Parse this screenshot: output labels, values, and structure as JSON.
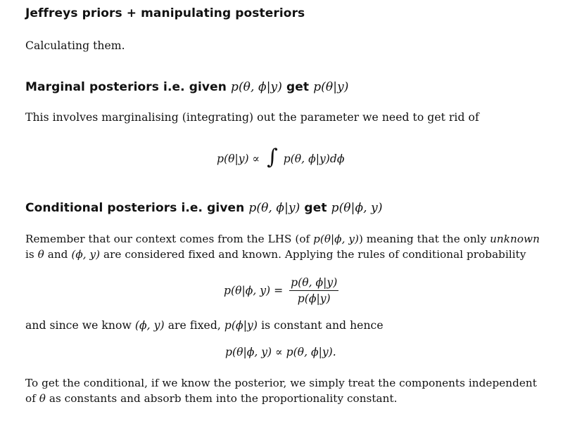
{
  "title": "Jeffreys priors + manipulating posteriors",
  "intro": "Calculating them.",
  "section1": {
    "heading_text": "Marginal posteriors i.e. given",
    "heading_math1": "p(θ, ϕ|y)",
    "heading_mid": "get",
    "heading_math2": "p(θ|y)",
    "body": "This involves marginalising (integrating) out the parameter we need to get rid of",
    "eq_lhs": "p(θ|y) ∝",
    "eq_integral": "∫",
    "eq_rhs": "p(θ, ϕ|y)dϕ"
  },
  "section2": {
    "heading_text": "Conditional posteriors i.e. given",
    "heading_math1": "p(θ, ϕ|y)",
    "heading_mid": "get",
    "heading_math2": "p(θ|ϕ, y)",
    "para1_line1_a": "Remember that our context comes from the LHS (of",
    "para1_line1_math": "p(θ|ϕ, y)",
    "para1_line1_b": ") meaning that the only",
    "para1_line1_em": "unknown",
    "para1_line2_a": "is",
    "para1_line2_math1": "θ",
    "para1_line2_b": "and",
    "para1_line2_math2": "(ϕ, y)",
    "para1_line2_c": "are considered fixed and known. Applying the rules of conditional probability",
    "eq1_lhs": "p(θ|ϕ, y) =",
    "eq1_num": "p(θ, ϕ|y)",
    "eq1_den": "p(ϕ|y)",
    "para2_a": "and since we know",
    "para2_math1": "(ϕ, y)",
    "para2_b": "are fixed,",
    "para2_math2": "p(ϕ|y)",
    "para2_c": "is constant and hence",
    "eq2": "p(θ|ϕ, y) ∝ p(θ, ϕ|y).",
    "para3_line1": "To get the conditional, if we know the posterior, we simply treat the components independent",
    "para3_line2_a": "of",
    "para3_line2_math": "θ",
    "para3_line2_b": "as constants and absorb them into the proportionality constant."
  }
}
